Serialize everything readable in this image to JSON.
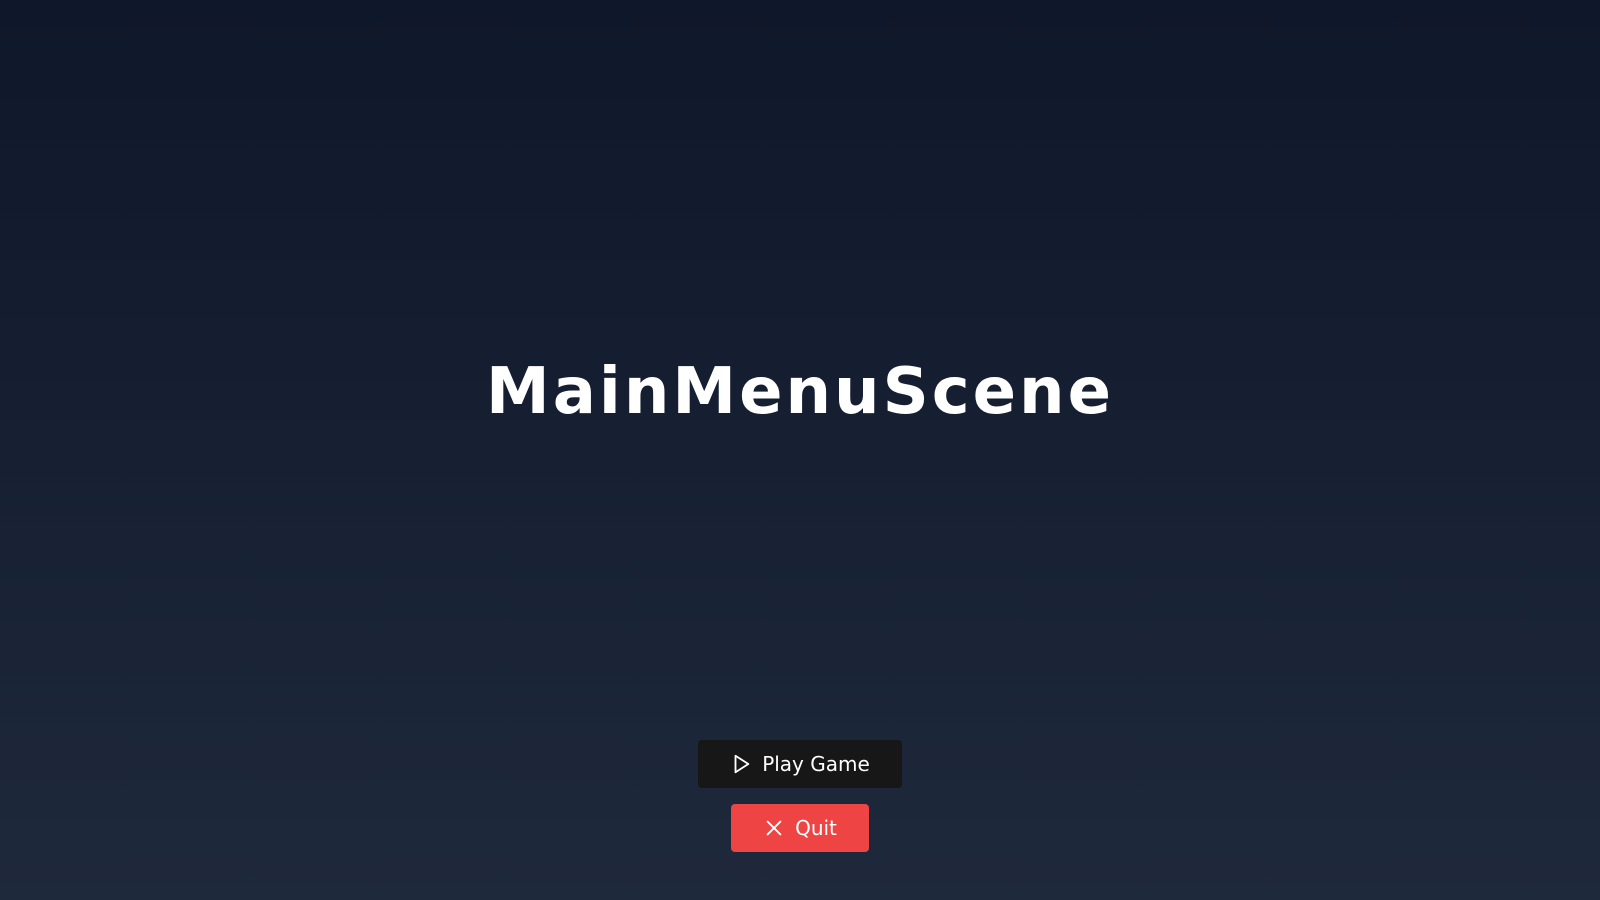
{
  "scene": {
    "title": "MainMenuScene"
  },
  "menu": {
    "play_label": "Play Game",
    "play_icon": "play-icon",
    "quit_label": "Quit",
    "quit_icon": "close-icon"
  },
  "colors": {
    "background_top": "#0f172a",
    "background_bottom": "#1e293b",
    "play_button": "#171717",
    "quit_button": "#ef4444",
    "text": "#ffffff"
  }
}
